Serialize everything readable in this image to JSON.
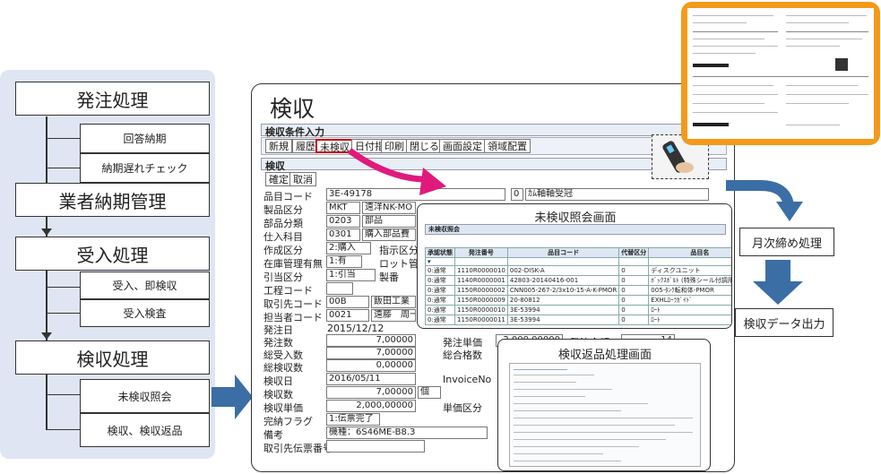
{
  "flow": {
    "steps": [
      {
        "label": "発注処理",
        "subs": [
          "回答納期",
          "納期遅れチェック"
        ]
      },
      {
        "label": "業者納期管理",
        "subs": []
      },
      {
        "label": "受入処理",
        "subs": [
          "受入、即検収",
          "受入検査"
        ]
      },
      {
        "label": "検収処理",
        "subs": [
          "未検収照会",
          "検収、検収返品"
        ]
      }
    ]
  },
  "main": {
    "title": "検収",
    "cond_group": "検収条件入力",
    "toolbar": [
      "新規",
      "履歴",
      "未検収",
      "日付指",
      "印刷",
      "閉じる",
      "画面設定",
      "領域配置"
    ],
    "kenshu_group": "検収",
    "confirm": "確定",
    "cancel": "取消",
    "fields": {
      "hinmoku_label": "品目コード",
      "hinmoku_value": "3E-49178",
      "hinmoku_rev": "0",
      "hinmoku_name": "ｶﾑ軸軸受冠",
      "seihin_label": "製品区分",
      "seihin_code": "MKT",
      "seihin_name": "遠洋NK-MO",
      "buhin_label": "部品分類",
      "buhin_code": "0203",
      "buhin_name": "部品",
      "shiire_label": "仕入科目",
      "shiire_code": "0301",
      "shiire_name": "購入部品費",
      "sakusei_label": "作成区分",
      "sakusei_value": "2:購入",
      "shiji_label": "指示区分",
      "zaiko_label": "在庫管理有無",
      "zaiko_value": "1:有",
      "lot_label": "ロット管",
      "hikiate_label": "引当区分",
      "hikiate_value": "1:引当",
      "seizo_label": "製番",
      "kotei_label": "工程コード",
      "torihiki_label": "取引先コード",
      "torihiki_code": "00B",
      "torihiki_name": "飯田工業",
      "tanto_label": "担当者コード",
      "tanto_code": "0021",
      "tanto_name": "遠藤　周一",
      "hacchubi_label": "発注日",
      "hacchubi_value": "2015/12/12",
      "hacchusu_label": "発注数",
      "hacchusu_value": "7,00000",
      "hacchutanka_label": "発注単価",
      "hacchutanka_value": "2,000,00000",
      "hacchukingaku_label": "発注金額",
      "hacchukingaku_value": "14",
      "soukeiju_label": "総受入数",
      "soukeiju_value": "7,00000",
      "sougou_label": "総合格数",
      "soukenshu_label": "総検収数",
      "soukenshu_value": "0,00000",
      "kenshubi_label": "検収日",
      "kenshubi_value": "2016/05/11",
      "invoice_label": "InvoiceNo",
      "kenshusu_label": "検収数",
      "kenshusu_value": "7,00000",
      "kenshusu_unit": "個",
      "kenshutanka_label": "検収単価",
      "kenshutanka_value": "2,000,00000",
      "tanka_kubun_label": "単価区分",
      "kannou_label": "完納フラグ",
      "kannou_value": "1:伝票完了",
      "biko_label": "備考",
      "biko_value": "機種：6S46ME-B8.3",
      "denpyo_label": "取引先伝票番号"
    }
  },
  "popup1": {
    "title": "未検収照会画面",
    "header": "未検収照会",
    "columns": [
      "承認状態",
      "発注番号",
      "品目コード",
      "代替区分",
      "品目名"
    ],
    "rows": [
      [
        "0:通常",
        "1110R0000010",
        "002-DISK-A",
        "0",
        "ディスクユニット"
      ],
      [
        "0:通常",
        "1140R0000001",
        "42803-20140416-001",
        "0",
        "ﾎﾞｯｸｽﾎﾞﾙﾄ (特殊シール付調用材料)"
      ],
      [
        "0:通常",
        "1150R0000002",
        "CNN005-267-2/3x10-15-A-K-PMOR",
        "0",
        "005-ﾀﾝｸ転和体-PMOR"
      ],
      [
        "0:通常",
        "1150R0000009",
        "20-80812",
        "0",
        "EXHLﾛｰﾗｶﾞｲﾄﾞ"
      ],
      [
        "0:通常",
        "1150R0000010",
        "3E-53994",
        "0",
        "ﾛｰﾄ"
      ],
      [
        "0:通常",
        "1150R0000011",
        "3E-53994",
        "0",
        "ﾛｰﾄ"
      ]
    ]
  },
  "popup2": {
    "title": "検収返品処理画面"
  },
  "right": {
    "monthly": "月次締め処理",
    "output": "検収データ出力"
  },
  "colors": {
    "flow_bg": "#dfe5f3",
    "arrow_blue": "#3a6ea5",
    "highlight": "#c00000",
    "magenta": "#e0197d",
    "doc_frame": "#f39a1b"
  }
}
